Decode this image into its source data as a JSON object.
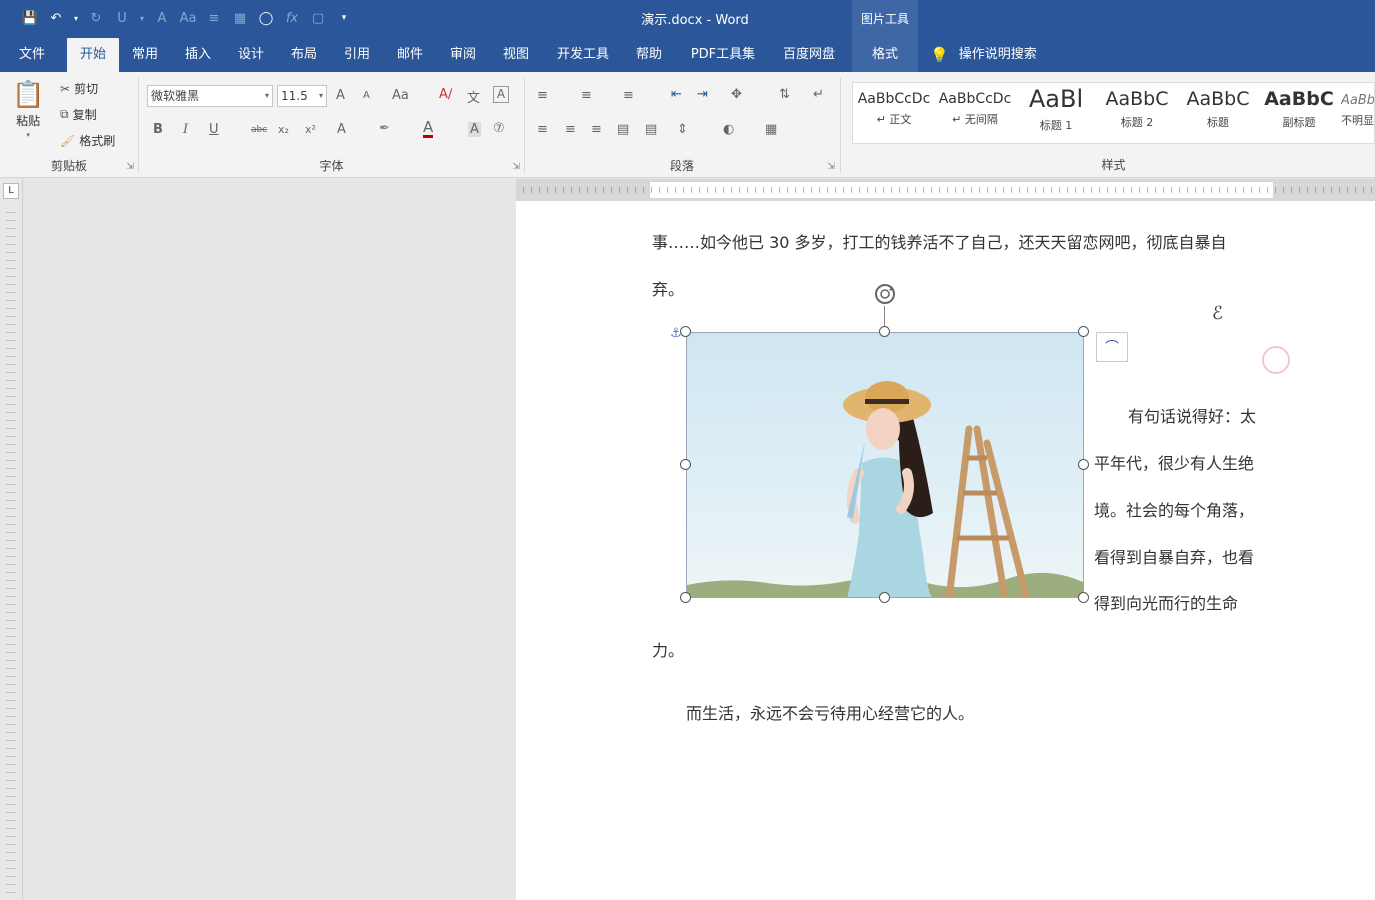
{
  "titlebar": {
    "title": "演示.docx  -  Word",
    "context_group": "图片工具"
  },
  "qat": [
    "save-icon",
    "undo-icon",
    "redo-icon",
    "underline-icon",
    "font-color-icon",
    "change-case-icon",
    "bullets-icon",
    "shading-icon",
    "shape-icon",
    "fx-icon",
    "screenshot-icon",
    "customize-icon"
  ],
  "tabs": [
    {
      "label": "文件"
    },
    {
      "label": "开始"
    },
    {
      "label": "常用"
    },
    {
      "label": "插入"
    },
    {
      "label": "设计"
    },
    {
      "label": "布局"
    },
    {
      "label": "引用"
    },
    {
      "label": "邮件"
    },
    {
      "label": "审阅"
    },
    {
      "label": "视图"
    },
    {
      "label": "开发工具"
    },
    {
      "label": "帮助"
    },
    {
      "label": "PDF工具集"
    },
    {
      "label": "百度网盘"
    },
    {
      "label": "格式"
    }
  ],
  "tellme": "操作说明搜索",
  "clipboard": {
    "paste": "粘贴",
    "cut": "剪切",
    "copy": "复制",
    "format_painter": "格式刷",
    "label": "剪贴板"
  },
  "font": {
    "name": "微软雅黑",
    "size": "11.5",
    "label": "字体",
    "bold": "B",
    "italic": "I",
    "underline": "U",
    "strike": "abc",
    "sub": "x₂",
    "sup": "x²",
    "grow": "A",
    "shrink": "A",
    "case": "Aa",
    "color": "A"
  },
  "paragraph": {
    "label": "段落"
  },
  "styles": {
    "label": "样式",
    "items": [
      {
        "sample": "AaBbCcDc",
        "name": "↵ 正文"
      },
      {
        "sample": "AaBbCcDc",
        "name": "↵ 无间隔"
      },
      {
        "sample": "AaBl",
        "name": "标题 1"
      },
      {
        "sample": "AaBbC",
        "name": "标题 2"
      },
      {
        "sample": "AaBbC",
        "name": "标题"
      },
      {
        "sample": "AaBbC",
        "name": "副标题"
      },
      {
        "sample": "AaBb",
        "name": "不明显"
      }
    ]
  },
  "document": {
    "line1": "事……如今他已 30 多岁，打工的钱养活不了自己，还天天留恋网吧，彻底自暴自",
    "line2": "弃。",
    "wrap1": "有句话说得好：太",
    "wrap2": "平年代，很少有人生绝",
    "wrap3": "境。社会的每个角落，",
    "wrap4": "看得到自暴自弃，也看",
    "wrap5": "得到向光而行的生命",
    "line3": "力。",
    "line4": "而生活，永远不会亏待用心经营它的人。"
  },
  "colors": {
    "accent": "#2b579a",
    "ribbon": "#f3f3f3",
    "font_color_bar": "#c00000"
  }
}
